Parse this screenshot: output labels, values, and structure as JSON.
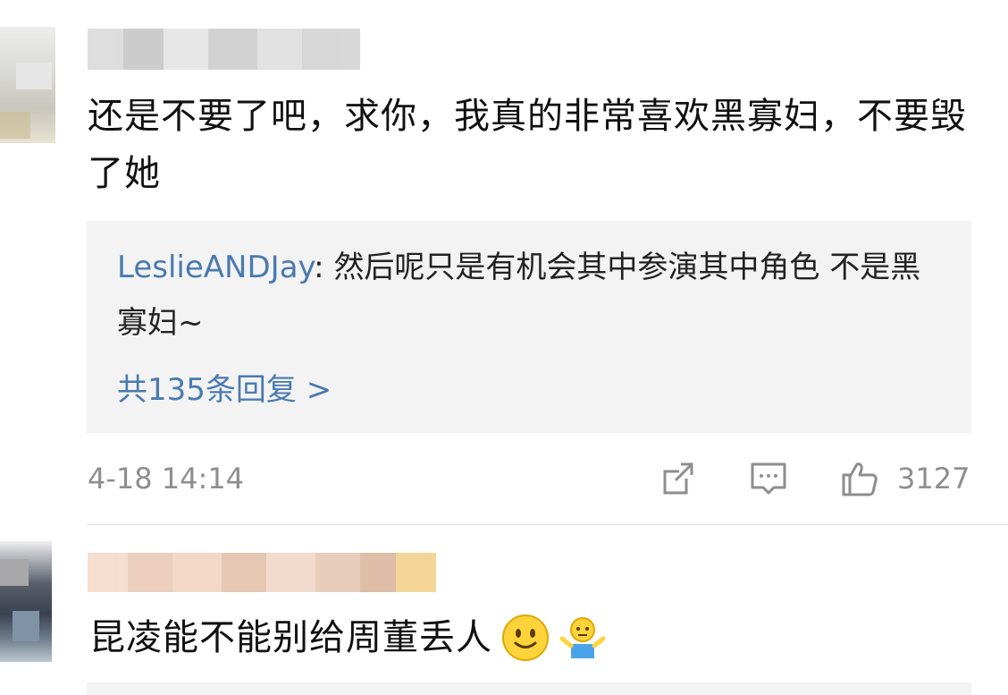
{
  "comments": [
    {
      "text": "还是不要了吧，求你，我真的非常喜欢黑寡妇，不要毁了她",
      "reply_preview": {
        "author": "LeslieANDJay",
        "separator": ": ",
        "text": "然后呢只是有机会其中参演其中角色 不是黑寡妇~",
        "more_label": "共135条回复 >"
      },
      "timestamp": "4-18 14:14",
      "actions": {
        "share_icon": "share-icon",
        "comment_icon": "comment-icon",
        "like_icon": "thumbs-up-icon",
        "like_count": "3127"
      }
    },
    {
      "text": "昆凌能不能别给周董丢人",
      "emojis": [
        "smiley-face-emoji",
        "shrug-emoji"
      ]
    }
  ],
  "colors": {
    "link": "#4a7ab0",
    "meta": "#8e8e8e",
    "reply_bg": "#f3f3f3"
  }
}
